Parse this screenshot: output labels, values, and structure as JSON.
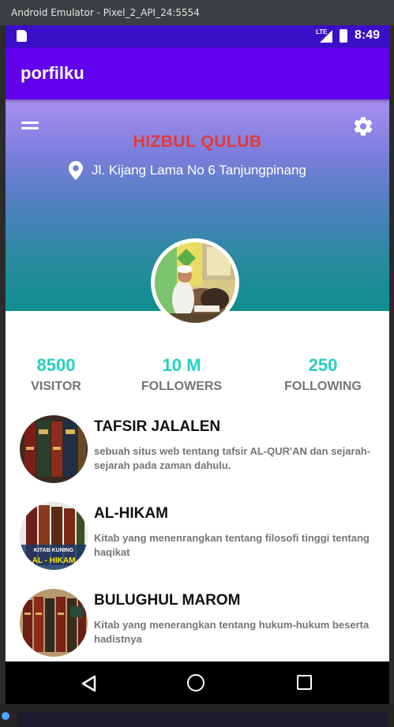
{
  "window": {
    "title": "Android Emulator - Pixel_2_API_24:5554"
  },
  "statusbar": {
    "network": "LTE",
    "time": "8:49",
    "icons": [
      "sd-card-icon",
      "signal-icon",
      "battery-icon"
    ]
  },
  "appbar": {
    "title": "porfilku"
  },
  "profile": {
    "name": "HIZBUL QULUB",
    "address": "Jl. Kijang Lama No 6 Tanjungpinang",
    "icons": [
      "menu-icon",
      "gear-icon",
      "location-pin-icon"
    ]
  },
  "stats": [
    {
      "value": "8500",
      "label": "VISITOR"
    },
    {
      "value": "10 M",
      "label": "FOLLOWERS"
    },
    {
      "value": "250",
      "label": "FOLLOWING"
    }
  ],
  "items": [
    {
      "title": "TAFSIR JALALEN",
      "description": "sebuah situs web tentang tafsir AL-QUR'AN dan sejarah-sejarah pada zaman dahulu."
    },
    {
      "title": "AL-HIKAM",
      "description": "Kitab yang menenrangkan tentang filosofi tinggi tentang haqikat",
      "thumb_text_top": "KITAB KUNING",
      "thumb_text_bottom": "AL - HIKAM"
    },
    {
      "title": "BULUGHUL MAROM",
      "description": "Kitab yang menerangkan tentang hukum-hukum beserta hadistnya"
    }
  ],
  "navigation": {
    "buttons": [
      "back-icon",
      "home-icon",
      "recent-apps-icon"
    ]
  },
  "colors": {
    "statusbar": "#3a0fc8",
    "appbar": "#6200ee",
    "brand": "#e53935",
    "stat_value": "#24d1c0",
    "stat_label": "#757575"
  }
}
